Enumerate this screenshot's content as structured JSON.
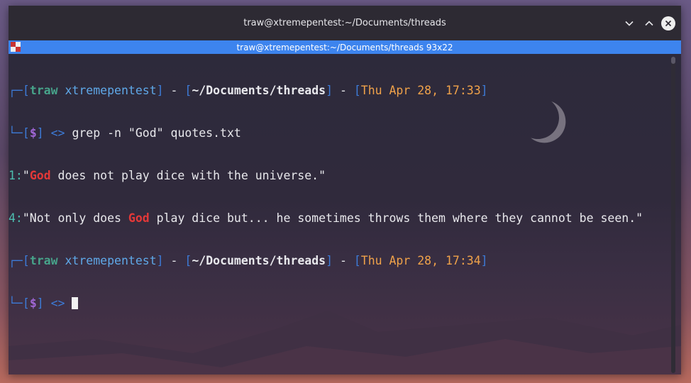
{
  "window": {
    "title": "traw@xtremepentest:~/Documents/threads",
    "icons": [
      "chevron-down-icon",
      "chevron-up-icon",
      "close-icon"
    ]
  },
  "tab": {
    "label": "traw@xtremepentest:~/Documents/threads 93x22",
    "icon": "terminal-app-icon"
  },
  "colors": {
    "accent": "#3d84ee",
    "user": "#47a38a",
    "time": "#f0a24a",
    "match": "#e43838",
    "prompt": "#a067d6"
  },
  "session": {
    "user": "traw",
    "host": "xtremepentest",
    "cwd": "~/Documents/threads",
    "time1": "Thu Apr 28, 17:33",
    "time2": "Thu Apr 28, 17:34",
    "prompt_symbol": "$",
    "arrow": "<>",
    "command": "grep -n \"God\" quotes.txt"
  },
  "output": [
    {
      "lineno": "1:",
      "before": "\"",
      "match": "God",
      "after": " does not play dice with the universe.\""
    },
    {
      "lineno": "4:",
      "before": "\"Not only does ",
      "match": "God",
      "after": " play dice but... he sometimes throws them where they cannot be seen.\""
    }
  ]
}
